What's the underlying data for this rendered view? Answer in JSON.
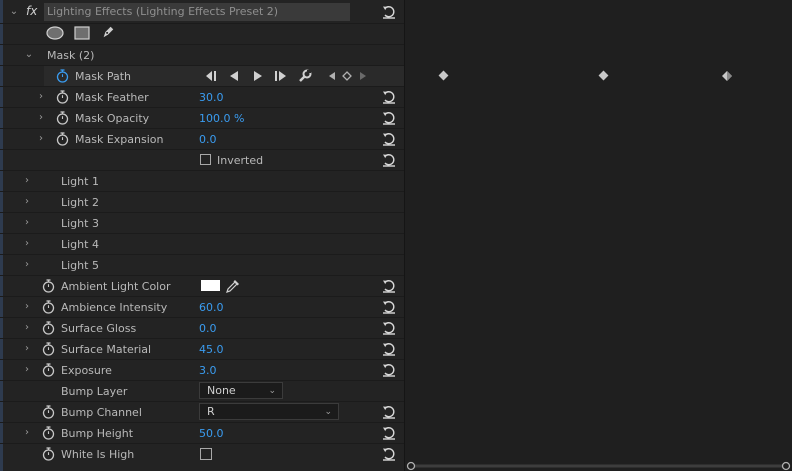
{
  "effect": {
    "fx": "fx",
    "title": "Lighting Effects (Lighting Effects Preset 2)"
  },
  "shape_tools": {
    "ellipse": "ellipse-tool",
    "rect": "rectangle-tool",
    "pen": "pen-tool"
  },
  "mask": {
    "header": "Mask (2)",
    "path_label": "Mask Path",
    "feather_label": "Mask Feather",
    "feather_value": "30.0",
    "opacity_label": "Mask Opacity",
    "opacity_value": "100.0 %",
    "expansion_label": "Mask Expansion",
    "expansion_value": "0.0",
    "inverted_label": "Inverted"
  },
  "lights": [
    "Light 1",
    "Light 2",
    "Light 3",
    "Light 4",
    "Light 5"
  ],
  "props": {
    "ambient_color_label": "Ambient Light Color",
    "ambience_label": "Ambience Intensity",
    "ambience_value": "60.0",
    "gloss_label": "Surface Gloss",
    "gloss_value": "0.0",
    "material_label": "Surface Material",
    "material_value": "45.0",
    "exposure_label": "Exposure",
    "exposure_value": "3.0",
    "bump_layer_label": "Bump Layer",
    "bump_layer_value": "None",
    "bump_channel_label": "Bump Channel",
    "bump_channel_value": "R",
    "bump_height_label": "Bump Height",
    "bump_height_value": "50.0",
    "white_high_label": "White Is High"
  },
  "colors": {
    "accent": "#3a9cf0",
    "ambient_swatch": "#ffffff"
  }
}
